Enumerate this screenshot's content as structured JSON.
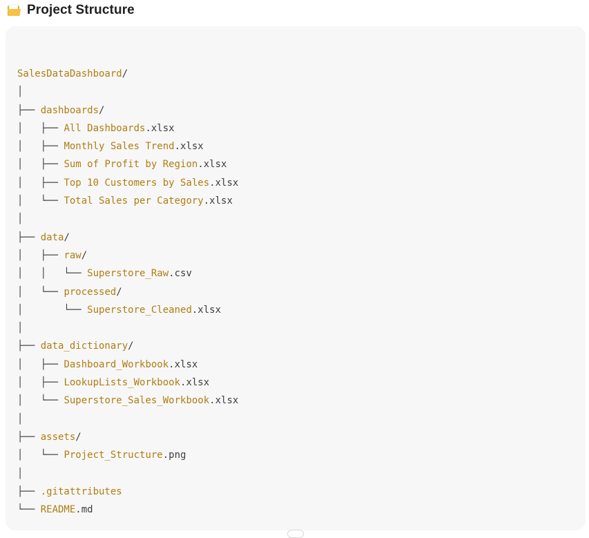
{
  "heading": {
    "icon": "folder-icon",
    "title": "Project Structure"
  },
  "tree": {
    "lines": [
      {
        "guide": "",
        "name": "SalesDataDashboard",
        "suffix": "/"
      },
      {
        "guide": "│",
        "name": "",
        "suffix": ""
      },
      {
        "guide": "├── ",
        "name": "dashboards",
        "suffix": "/"
      },
      {
        "guide": "│   ├── ",
        "name": "All Dashboards",
        "suffix": ".xlsx"
      },
      {
        "guide": "│   ├── ",
        "name": "Monthly Sales Trend",
        "suffix": ".xlsx"
      },
      {
        "guide": "│   ├── ",
        "name": "Sum of Profit by Region",
        "suffix": ".xlsx"
      },
      {
        "guide": "│   ├── ",
        "name": "Top 10 Customers by Sales",
        "suffix": ".xlsx"
      },
      {
        "guide": "│   └── ",
        "name": "Total Sales per Category",
        "suffix": ".xlsx"
      },
      {
        "guide": "│",
        "name": "",
        "suffix": ""
      },
      {
        "guide": "├── ",
        "name": "data",
        "suffix": "/"
      },
      {
        "guide": "│   ├── ",
        "name": "raw",
        "suffix": "/"
      },
      {
        "guide": "│   │   └── ",
        "name": "Superstore_Raw",
        "suffix": ".csv"
      },
      {
        "guide": "│   └── ",
        "name": "processed",
        "suffix": "/"
      },
      {
        "guide": "│       └── ",
        "name": "Superstore_Cleaned",
        "suffix": ".xlsx"
      },
      {
        "guide": "│",
        "name": "",
        "suffix": ""
      },
      {
        "guide": "├── ",
        "name": "data_dictionary",
        "suffix": "/"
      },
      {
        "guide": "│   ├── ",
        "name": "Dashboard_Workbook",
        "suffix": ".xlsx"
      },
      {
        "guide": "│   ├── ",
        "name": "LookupLists_Workbook",
        "suffix": ".xlsx"
      },
      {
        "guide": "│   └── ",
        "name": "Superstore_Sales_Workbook",
        "suffix": ".xlsx"
      },
      {
        "guide": "│",
        "name": "",
        "suffix": ""
      },
      {
        "guide": "├── ",
        "name": "assets",
        "suffix": "/"
      },
      {
        "guide": "│   └── ",
        "name": "Project_Structure",
        "suffix": ".png"
      },
      {
        "guide": "│",
        "name": "",
        "suffix": ""
      },
      {
        "guide": "├── ",
        "name": ".gitattributes",
        "suffix": ""
      },
      {
        "guide": "└── ",
        "name": "README",
        "suffix": ".md"
      }
    ]
  },
  "colors": {
    "name_accent": "#b07d12",
    "panel_bg": "#f7f7f7",
    "folder_icon": "#f2b632"
  }
}
